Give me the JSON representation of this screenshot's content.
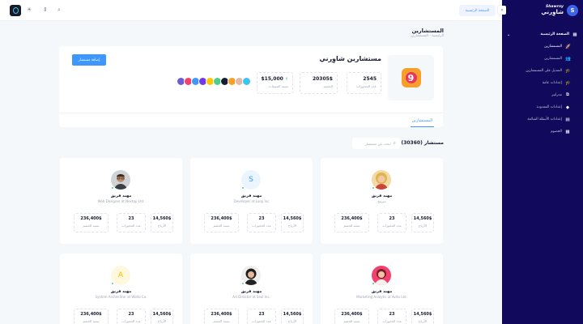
{
  "brand": {
    "latin": "Shawrny",
    "arabic": "شاوِرني",
    "logo_letter": "S"
  },
  "topbar": {
    "home_button": "الصفحة الرئيسية"
  },
  "sidebar": {
    "items": [
      {
        "label": "الصفحة الرئيسية",
        "icon": "grid-icon",
        "glyph": "▦",
        "type": "parent"
      },
      {
        "label": "المستشارين",
        "icon": "rocket-icon",
        "glyph": "🚀",
        "type": "sub",
        "active": true
      },
      {
        "label": "المستشارين",
        "icon": "users-icon",
        "glyph": "👥",
        "type": "sub"
      },
      {
        "label": "التعديل على المستشارين",
        "icon": "hat-icon",
        "glyph": "🎓",
        "type": "sub"
      },
      {
        "label": "إعدادات عامة",
        "icon": "hat-icon",
        "glyph": "🎓",
        "type": "sub"
      },
      {
        "label": "مدراتير",
        "icon": "layers-icon",
        "glyph": "⧉",
        "type": "sub"
      },
      {
        "label": "إعدادات المعدودة",
        "icon": "diamond-icon",
        "glyph": "◆",
        "type": "sub"
      },
      {
        "label": "إعدادات الأسئلة الشائعة",
        "icon": "bars-icon",
        "glyph": "▤",
        "type": "sub"
      },
      {
        "label": "الخصوم",
        "icon": "calendar-icon",
        "glyph": "▦",
        "type": "sub"
      }
    ]
  },
  "page": {
    "title": "المستشارين",
    "breadcrumb": "الرئيسية - المستشارين"
  },
  "header_card": {
    "company": "مستشارين شاوِرني",
    "add_button": "إضافة مستشار",
    "tab": "المستشارين",
    "stats": [
      {
        "value": "2545",
        "label": "عدد الحجوزات"
      },
      {
        "value": "20305$",
        "label": "الخصم"
      },
      {
        "value": "$15,000",
        "label": "نسبة المبيعات",
        "trend": "up"
      }
    ],
    "avatars": [
      "#6d5cd6",
      "#f1416c",
      "#3e97ff",
      "#7239ea",
      "#ffc700",
      "#50cd89",
      "#181c32",
      "#f6a02b",
      "#e4b9a4",
      "#3bc4f1"
    ]
  },
  "list": {
    "title": "مستشار (30360)",
    "search_placeholder": "ابحث عن مستشار"
  },
  "cards": [
    {
      "name": "مهند قريق",
      "position": "مبرمج",
      "avatar": "woman-blonde",
      "stats": [
        {
          "value": "14,560$",
          "label": "الأرباح"
        },
        {
          "value": "23",
          "label": "عدد الحجوزات"
        },
        {
          "value": "236,400$",
          "label": "نسبة الخصم"
        }
      ]
    },
    {
      "name": "مهند قريق",
      "position": "Developer at Loop Inc",
      "avatar": "letter-S",
      "stats": [
        {
          "value": "14,560$",
          "label": "الأرباح"
        },
        {
          "value": "23",
          "label": "عدد الحجوزات"
        },
        {
          "value": "236,400$",
          "label": "نسبة الخصم"
        }
      ]
    },
    {
      "name": "مهند قريق",
      "position": "Web Designer at Nextop Ltd.",
      "avatar": "man-glasses",
      "stats": [
        {
          "value": "14,560$",
          "label": "الأرباح"
        },
        {
          "value": "23",
          "label": "عدد الحجوزات"
        },
        {
          "value": "236,400$",
          "label": "نسبة الخصم"
        }
      ]
    },
    {
      "name": "مهند قريق",
      "position": "Marketing Analytic at Avito Ltd.",
      "avatar": "woman-red",
      "stats": [
        {
          "value": "14,560$",
          "label": "الأرباح"
        },
        {
          "value": "23",
          "label": "عدد الحجوزات"
        },
        {
          "value": "236,400$",
          "label": "نسبة الخصم"
        }
      ]
    },
    {
      "name": "مهند قريق",
      "position": "Art Director at Seal Inc.",
      "avatar": "woman-dark",
      "stats": [
        {
          "value": "14,560$",
          "label": "الأرباح"
        },
        {
          "value": "23",
          "label": "عدد الحجوزات"
        },
        {
          "value": "236,400$",
          "label": "نسبة الخصم"
        }
      ]
    },
    {
      "name": "مهند قريق",
      "position": "System Arcitechtor at Wolto Co.",
      "avatar": "letter-A",
      "stats": [
        {
          "value": "14,560$",
          "label": "الأرباح"
        },
        {
          "value": "23",
          "label": "عدد الحجوزات"
        },
        {
          "value": "236,400$",
          "label": "نسبة الخصم"
        }
      ]
    }
  ],
  "colors": {
    "sidebar": "#110a5c",
    "primary": "#3e97ff",
    "success": "#50cd89"
  }
}
